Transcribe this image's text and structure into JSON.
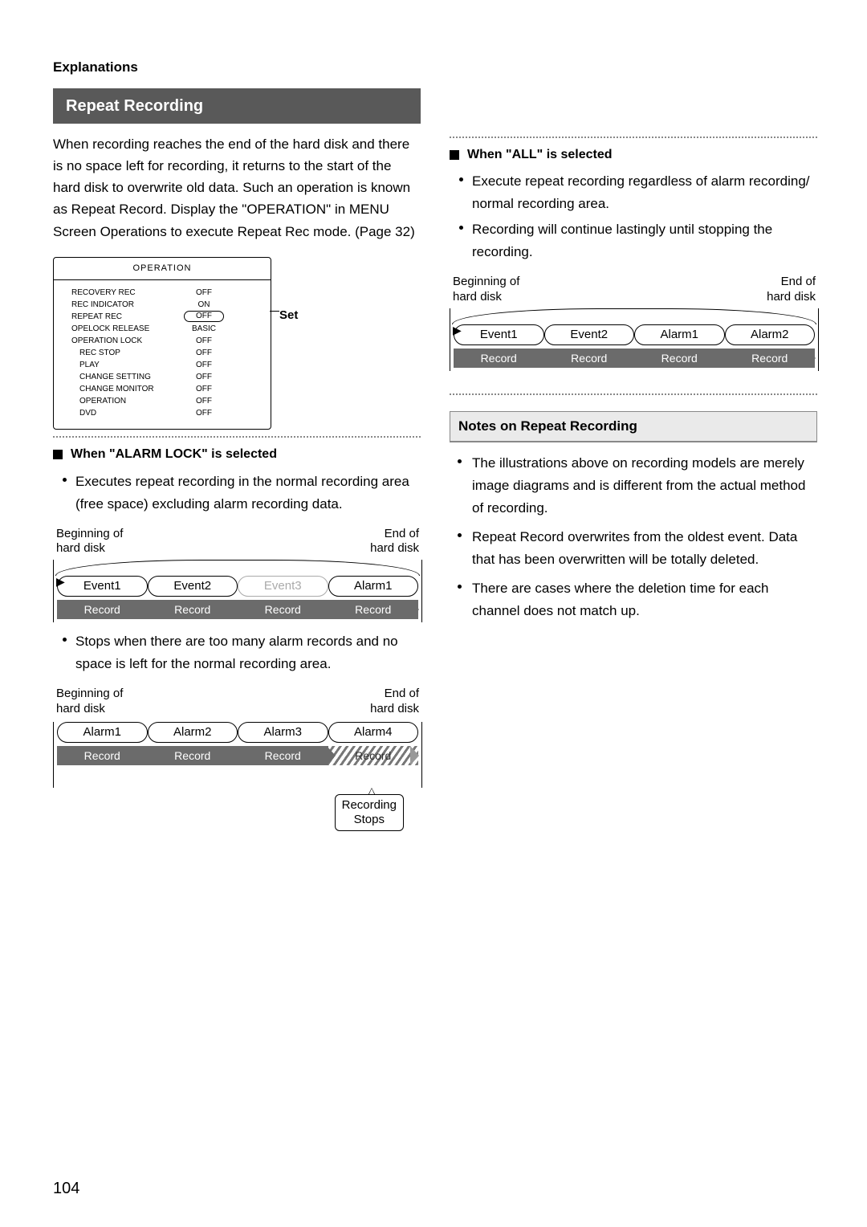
{
  "explanations": "Explanations",
  "heading": "Repeat Recording",
  "intro": "When recording reaches the end of the hard disk and there is no space left for recording, it returns to the start of the hard disk to overwrite old data. Such an operation is known as Repeat Record. Display the \"OPERATION\" in MENU Screen Operations to execute Repeat Rec mode. (Page 32)",
  "menu": {
    "title": "OPERATION",
    "rows": [
      {
        "label": "RECOVERY REC",
        "value": "OFF"
      },
      {
        "label": "REC INDICATOR",
        "value": "ON"
      },
      {
        "label": "REPEAT REC",
        "value": "OFF",
        "highlight": true
      },
      {
        "label": "OPELOCK RELEASE",
        "value": "BASIC"
      },
      {
        "label": "OPERATION LOCK",
        "value": "OFF"
      },
      {
        "label": "REC STOP",
        "value": "OFF",
        "indent": true
      },
      {
        "label": "PLAY",
        "value": "OFF",
        "indent": true
      },
      {
        "label": "CHANGE SETTING",
        "value": "OFF",
        "indent": true
      },
      {
        "label": "CHANGE MONITOR",
        "value": "OFF",
        "indent": true
      },
      {
        "label": "OPERATION",
        "value": "OFF",
        "indent": true
      },
      {
        "label": "DVD",
        "value": "OFF",
        "indent": true
      }
    ],
    "set": "Set"
  },
  "alarmlock": {
    "title": "When \"ALARM LOCK\" is selected",
    "b1": "Executes repeat recording in the normal recording area (free space) excluding alarm recording data.",
    "b2": "Stops when there are too many alarm records and no space is left for the normal recording area."
  },
  "all": {
    "title": "When \"ALL\" is selected",
    "b1": "Execute repeat recording regardless of alarm recording/ normal recording area.",
    "b2": "Recording will continue lastingly until stopping the recording."
  },
  "dlabels": {
    "begin": "Beginning of\nhard disk",
    "end": "End of\nhard disk",
    "record": "Record",
    "recstops": "Recording\nStops"
  },
  "d1": {
    "segs": [
      "Event1",
      "Event2",
      "Event3",
      "Alarm1"
    ],
    "dim": [
      false,
      false,
      true,
      false
    ]
  },
  "d2": {
    "segs": [
      "Alarm1",
      "Alarm2",
      "Alarm3",
      "Alarm4"
    ]
  },
  "d3": {
    "segs": [
      "Event1",
      "Event2",
      "Alarm1",
      "Alarm2"
    ]
  },
  "notes": {
    "title": "Notes on Repeat Recording",
    "items": [
      "The illustrations above on recording models are merely image diagrams and is different from the actual method of recording.",
      "Repeat Record overwrites from the oldest event. Data that has been overwritten will be totally deleted.",
      "There are cases where the deletion time for each channel does not match up."
    ]
  },
  "pagenum": "104"
}
